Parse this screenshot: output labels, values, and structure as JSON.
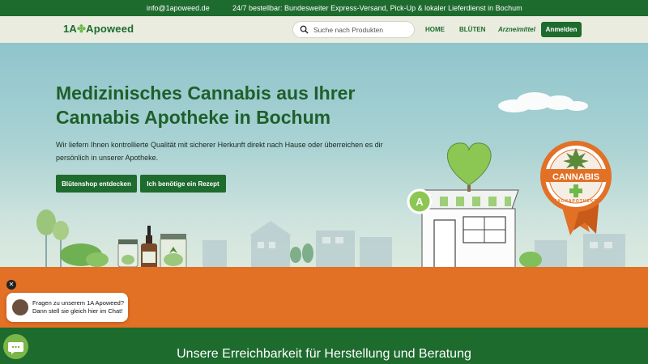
{
  "topbar": {
    "email": "info@1apoweed.de",
    "message": "24/7 bestellbar: Bundesweiter Express-Versand, Pick-Up & lokaler Lieferdienst in Bochum"
  },
  "header": {
    "logo_left": "1A",
    "logo_right": "Apoweed",
    "search_placeholder": "Suche nach Produkten",
    "nav": [
      "HOME",
      "BLÜTEN",
      "Arzneimittel"
    ],
    "login_label": "Anmelden"
  },
  "hero": {
    "title": "Medizinisches Cannabis aus Ihrer Cannabis Apotheke in Bochum",
    "text": "Wir liefern Ihnen kontrollierte Qualität mit sicherer Herkunft direkt nach Hause oder überreichen es dir persönlich in unserer Apotheke.",
    "button_shop": "Blütenshop entdecken",
    "button_rezept": "Ich benötige ein Rezept"
  },
  "badge": {
    "label": "CANNABIS",
    "sublabel": "FACHAPOTHEKE"
  },
  "chat": {
    "line1": "Fragen zu unserem 1A Apoweed?",
    "line2": "Dann stell sie gleich hier im Chat!"
  },
  "section": {
    "heading": "Unsere Erreichbarkeit für Herstellung und Beratung"
  },
  "colors": {
    "brand_green": "#1e6b2e",
    "accent_orange": "#e27025",
    "leaf_green": "#7ab648"
  }
}
